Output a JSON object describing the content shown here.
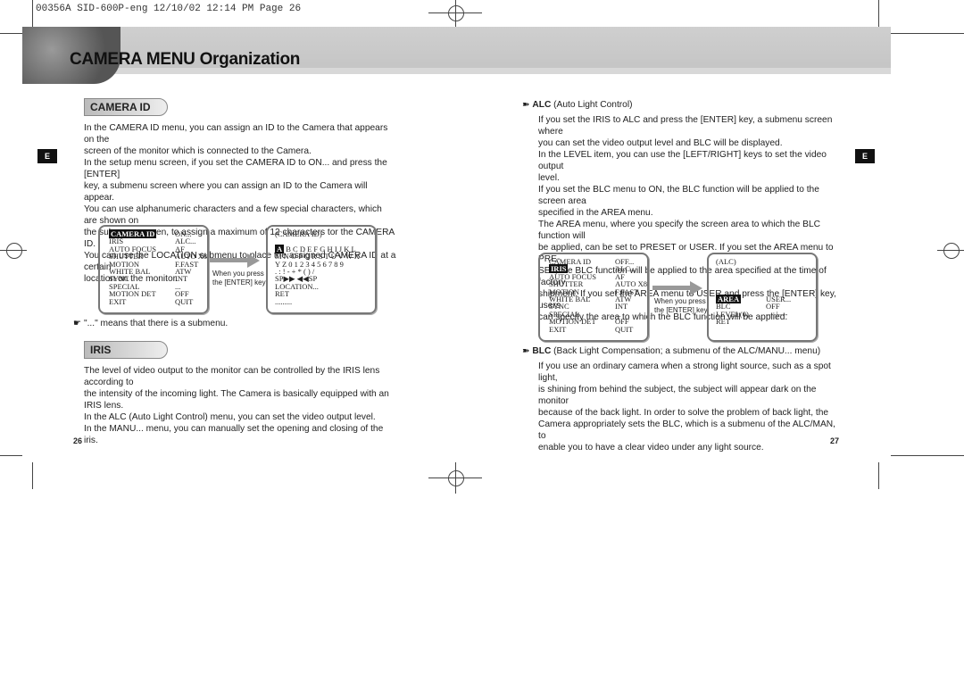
{
  "print_header": "00356A SID-600P-eng   12/10/02 12:14 PM   Page 26",
  "page_title": "CAMERA MENU Organization",
  "side_tab": "E",
  "camera_id": {
    "heading": "CAMERA ID",
    "lines": [
      "In the CAMERA ID menu, you can assign an ID to the Camera that appears on the",
      "screen of the monitor which is connected to the Camera.",
      "In the setup menu screen, if you set the CAMERA ID to ON... and press the [ENTER]",
      "key, a submenu screen where you can assign an ID to the Camera will appear.",
      "You can use alphanumeric characters and a few special characters, which are shown on",
      "the submenu screen, to assign a maximum of 12 characters tor the CAMERA ID.",
      "You can use the LOCATION submenu to place the assigned CAMERA ID at a certain",
      "location on the monitor."
    ],
    "menu": [
      [
        "CAMERA ID",
        "ON..."
      ],
      [
        "IRIS",
        "ALC..."
      ],
      [
        "AUTO FOCUS",
        "AF"
      ],
      [
        "SHUTTER",
        "AUTO X8"
      ],
      [
        "MOTION",
        "F.FAST"
      ],
      [
        "WHITE BAL",
        "ATW"
      ],
      [
        "SYNC",
        "INT"
      ],
      [
        "SPECIAL",
        "..."
      ],
      [
        "MOTION DET",
        "OFF"
      ],
      [
        "EXIT",
        "QUIT"
      ]
    ],
    "enter_note": [
      "When you press",
      "the [ENTER] key"
    ],
    "submenu": [
      "(CAMERA ID)",
      "",
      "A B C D E F G H I J K L",
      "M N O P Q R S T U V W X",
      "Y Z 0 1 2 3 4 5 6 7 8 9",
      ". : ! - + * ( ) /",
      "SP▶▶ ◀◀SP",
      "LOCATION...",
      "RET",
      "........."
    ],
    "note": "\"...\" means that there is a submenu."
  },
  "iris": {
    "heading": "IRIS",
    "lines": [
      "The level of video output to the monitor can be controlled by the IRIS lens according to",
      "the intensity of the incoming light. The Camera is basically equipped with an IRIS lens.",
      "In the ALC (Auto Light Control) menu, you can set the video output level.",
      "In the MANU... menu, you can manually set the opening and closing of the iris."
    ]
  },
  "alc": {
    "heading": "ALC",
    "heading_note": "(Auto Light Control)",
    "lines": [
      "If you set the IRIS to ALC and press the [ENTER] key, a submenu screen where",
      "you can set the video output level and BLC will be displayed.",
      "In the LEVEL item, you can use the [LEFT/RIGHT] keys to set the video output",
      "level.",
      "If you set the BLC menu to ON, the BLC function will be applied to the screen area",
      "specified in the AREA menu.",
      "The AREA menu, where you specify the screen area to which the BLC function will",
      "be applied, can be set to PRESET or USER. If you set the AREA menu to PRE-",
      "SET, the BLC function will be applied to the area specified at the time of factory",
      "shipment. If you set the AREA menu to USER and press the [ENTER] key, users",
      "can specify the area to which the BLC function will be applied."
    ],
    "menu": [
      [
        "CAMERA ID",
        "OFF..."
      ],
      [
        "IRIS",
        "ALC..."
      ],
      [
        "AUTO FOCUS",
        "AF"
      ],
      [
        "SHUTTER",
        "AUTO X8"
      ],
      [
        "MOTION",
        "F.FAST"
      ],
      [
        "WHITE BAL",
        "ATW"
      ],
      [
        "SYNC",
        "INT"
      ],
      [
        "SPECIAL",
        "..."
      ],
      [
        "MOTION DET",
        "OFF"
      ],
      [
        "EXIT",
        "QUIT"
      ]
    ],
    "enter_note": [
      "When you press",
      "the [ENTER] key"
    ],
    "submenu_title": "(ALC)",
    "submenu": [
      [
        "AREA",
        "USER..."
      ],
      [
        "BLC",
        "OFF"
      ],
      [
        "LEVEL(0)",
        "----|----"
      ],
      [
        "RET",
        ""
      ]
    ]
  },
  "blc": {
    "heading": "BLC",
    "heading_note": "(Back Light Compensation; a submenu of the ALC/MANU... menu)",
    "lines": [
      "If you use an ordinary camera when a strong light source, such as a spot light,",
      "is shining from behind the subject, the subject will appear dark on the monitor",
      "because of the back light. In order to solve the problem of back light, the",
      "Camera appropriately sets the BLC, which is a submenu of the ALC/MAN, to",
      "enable you to have a clear video under any light source."
    ]
  },
  "page_left": "26",
  "page_right": "27"
}
